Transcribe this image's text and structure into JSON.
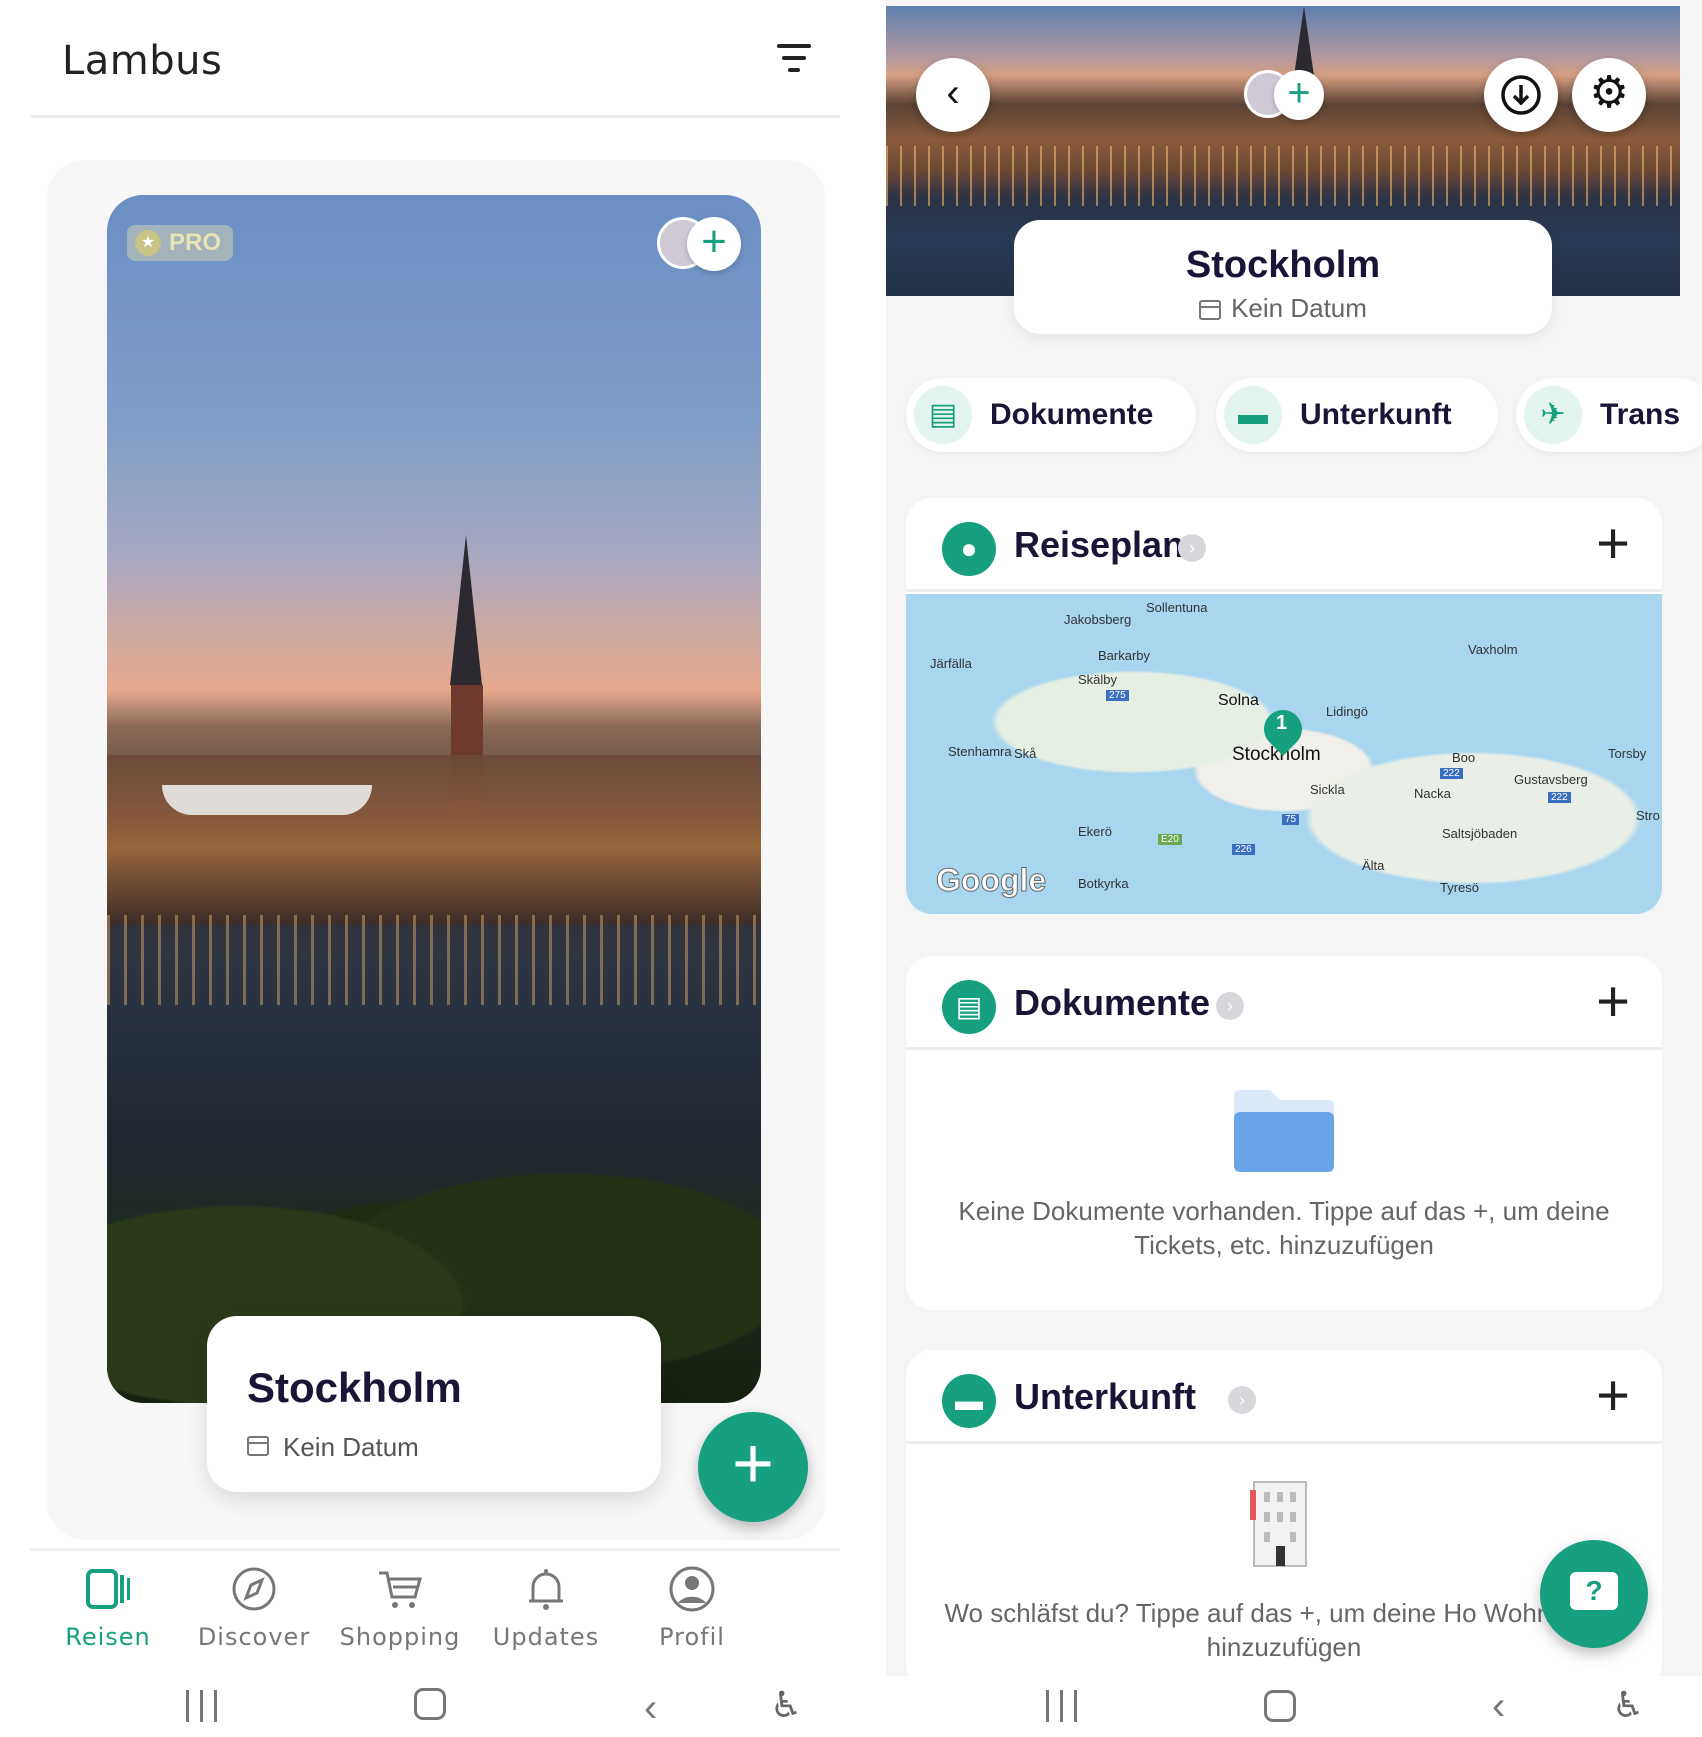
{
  "left": {
    "app_title": "Lambus",
    "trip": {
      "badge": "PRO",
      "name": "Stockholm",
      "date": "Kein Datum"
    },
    "nav": [
      {
        "label": "Reisen",
        "active": true
      },
      {
        "label": "Discover",
        "active": false
      },
      {
        "label": "Shopping",
        "active": false
      },
      {
        "label": "Updates",
        "active": false
      },
      {
        "label": "Profil",
        "active": false
      }
    ],
    "fab_label": "+"
  },
  "right": {
    "trip": {
      "name": "Stockholm",
      "date": "Kein Datum"
    },
    "chips": [
      {
        "label": "Dokumente"
      },
      {
        "label": "Unterkunft"
      },
      {
        "label": "Trans"
      }
    ],
    "sections": {
      "reiseplan": {
        "title": "Reiseplan",
        "map_places": [
          "Sollentuna",
          "Jakobsberg",
          "Barkarby",
          "Järfälla",
          "Skälby",
          "Solna",
          "Lidingö",
          "Vaxholm",
          "Stenhamra",
          "Skå",
          "Stockholm",
          "Boo",
          "Torsby",
          "Sickla",
          "Nacka",
          "Gustavsberg",
          "Ekerö",
          "Saltsjöbaden",
          "Stro",
          "Botkyrka",
          "Älta",
          "Tyresö"
        ],
        "map_roads": [
          "275",
          "222",
          "222",
          "75",
          "E20",
          "226"
        ],
        "pin": "1",
        "map_credit": "Google"
      },
      "dokumente": {
        "title": "Dokumente",
        "empty_text": "Keine Dokumente vorhanden. Tippe auf das +, um deine Tickets, etc. hinzuzufügen"
      },
      "unterkunft": {
        "title": "Unterkunft",
        "empty_text": "Wo schläfst du? Tippe auf das +, um deine Ho Wohnungen hinzuzufügen"
      }
    },
    "help_label": "?"
  },
  "colors": {
    "accent": "#17a07f",
    "title_text": "#1a1436",
    "map_water": "#a9d6ef"
  },
  "icons": [
    "filter-icon",
    "star-icon",
    "add-person-icon",
    "calendar-icon",
    "reisen-icon",
    "discover-icon",
    "shopping-cart-icon",
    "bell-icon",
    "profile-icon",
    "back-icon",
    "download-icon",
    "gear-icon",
    "document-icon",
    "bed-icon",
    "plane-icon",
    "map-pin-icon",
    "chevron-right-icon",
    "plus-icon",
    "folder-icon",
    "building-icon",
    "help-icon"
  ]
}
